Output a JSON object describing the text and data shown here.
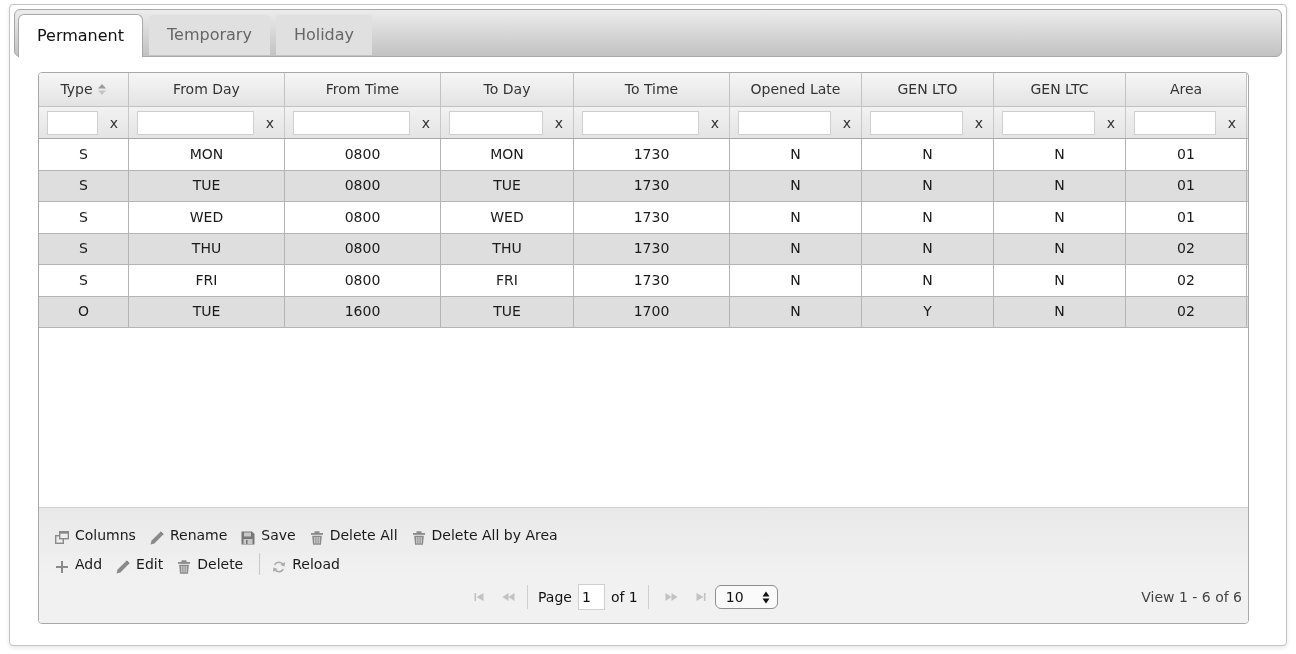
{
  "tabs": [
    {
      "label": "Permanent",
      "selected": true
    },
    {
      "label": "Temporary",
      "selected": false
    },
    {
      "label": "Holiday",
      "selected": false
    }
  ],
  "grid": {
    "columns": [
      {
        "label": "Type",
        "sortable": true,
        "clear": "x"
      },
      {
        "label": "From Day",
        "sortable": false,
        "clear": "x"
      },
      {
        "label": "From Time",
        "sortable": false,
        "clear": "x"
      },
      {
        "label": "To Day",
        "sortable": false,
        "clear": "x"
      },
      {
        "label": "To Time",
        "sortable": false,
        "clear": "x"
      },
      {
        "label": "Opened Late",
        "sortable": false,
        "clear": "x"
      },
      {
        "label": "GEN LTO",
        "sortable": false,
        "clear": "x"
      },
      {
        "label": "GEN LTC",
        "sortable": false,
        "clear": "x"
      },
      {
        "label": "Area",
        "sortable": false,
        "clear": "x"
      }
    ],
    "rows": [
      [
        "S",
        "MON",
        "0800",
        "MON",
        "1730",
        "N",
        "N",
        "N",
        "01"
      ],
      [
        "S",
        "TUE",
        "0800",
        "TUE",
        "1730",
        "N",
        "N",
        "N",
        "01"
      ],
      [
        "S",
        "WED",
        "0800",
        "WED",
        "1730",
        "N",
        "N",
        "N",
        "01"
      ],
      [
        "S",
        "THU",
        "0800",
        "THU",
        "1730",
        "N",
        "N",
        "N",
        "02"
      ],
      [
        "S",
        "FRI",
        "0800",
        "FRI",
        "1730",
        "N",
        "N",
        "N",
        "02"
      ],
      [
        "O",
        "TUE",
        "1600",
        "TUE",
        "1700",
        "N",
        "Y",
        "N",
        "02"
      ]
    ]
  },
  "toolbar": [
    [
      [
        {
          "label": "Columns",
          "kind": "columns"
        },
        {
          "label": "Rename",
          "kind": "edit"
        },
        {
          "label": "Save",
          "kind": "save"
        },
        {
          "label": "Delete All",
          "kind": "delete"
        },
        {
          "label": "Delete All by Area",
          "kind": "delete"
        }
      ]
    ],
    [
      [
        {
          "label": "Add",
          "kind": "add"
        },
        {
          "label": "Edit",
          "kind": "edit"
        },
        {
          "label": "Delete",
          "kind": "delete"
        }
      ],
      [
        {
          "label": "Reload",
          "kind": "reload"
        }
      ]
    ]
  ],
  "pager": {
    "nav_back": [
      {
        "kind": "first",
        "disabled": true
      },
      {
        "kind": "prev",
        "disabled": true
      }
    ],
    "page_label": "Page",
    "page": "1",
    "of_label": "of 1",
    "nav_forward": [
      {
        "kind": "next",
        "disabled": true
      },
      {
        "kind": "last",
        "disabled": true
      }
    ],
    "page_size": "10",
    "record_info": "View 1 - 6 of 6"
  }
}
